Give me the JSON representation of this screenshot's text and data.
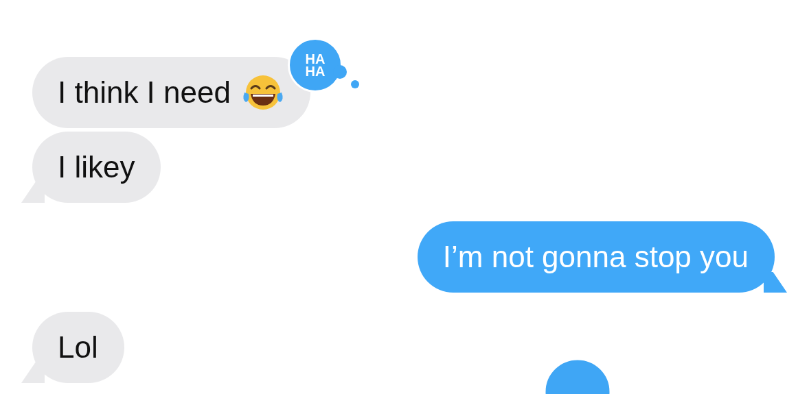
{
  "messages": [
    {
      "sent": false,
      "text": "I think I need",
      "has_emoji": true,
      "tail": false,
      "tapback": {
        "kind": "haha",
        "lines": [
          "HA",
          "HA"
        ]
      }
    },
    {
      "sent": false,
      "text": "I likey",
      "has_emoji": false,
      "tail": true
    },
    {
      "sent": true,
      "text": "I’m not gonna stop you",
      "has_emoji": false,
      "tail": true
    },
    {
      "sent": false,
      "text": "Lol",
      "has_emoji": false,
      "tail": true
    }
  ],
  "offscreen_tapback": true
}
